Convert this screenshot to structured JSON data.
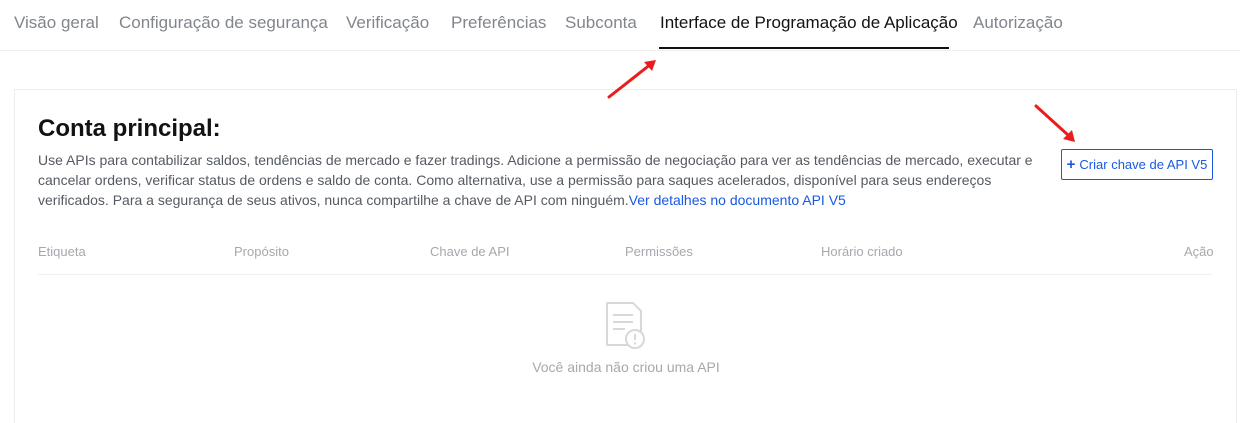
{
  "tabs": [
    {
      "label": "Visão geral"
    },
    {
      "label": "Configuração de segurança"
    },
    {
      "label": "Verificação"
    },
    {
      "label": "Preferências"
    },
    {
      "label": "Subconta"
    },
    {
      "label": "Interface de Programação de Aplicação",
      "active": true
    },
    {
      "label": "Autorização"
    }
  ],
  "section": {
    "title": "Conta principal:",
    "description": "Use APIs para contabilizar saldos, tendências de mercado e fazer tradings. Adicione a permissão de negociação para ver as tendências de mercado, executar e cancelar ordens, verificar status de ordens e saldo de conta. Como alternativa, use a permissão para saques acelerados, disponível para seus endereços verificados. Para a segurança de seus ativos, nunca compartilhe a chave de API com ninguém.",
    "doc_link": "Ver detalhes no documento API V5",
    "create_button": "Criar chave de API V5"
  },
  "table": {
    "columns": [
      "Etiqueta",
      "Propósito",
      "Chave de API",
      "Permissões",
      "Horário criado",
      "Ação"
    ],
    "empty_text": "Você ainda não criou uma API"
  },
  "colors": {
    "accent": "#1858e3",
    "annotation_arrow": "#e81e1e",
    "active_tab": "#121214",
    "inactive_tab": "#81858c"
  },
  "icons": {
    "create_button": "plus-icon",
    "empty_state": "document-warning-icon"
  }
}
